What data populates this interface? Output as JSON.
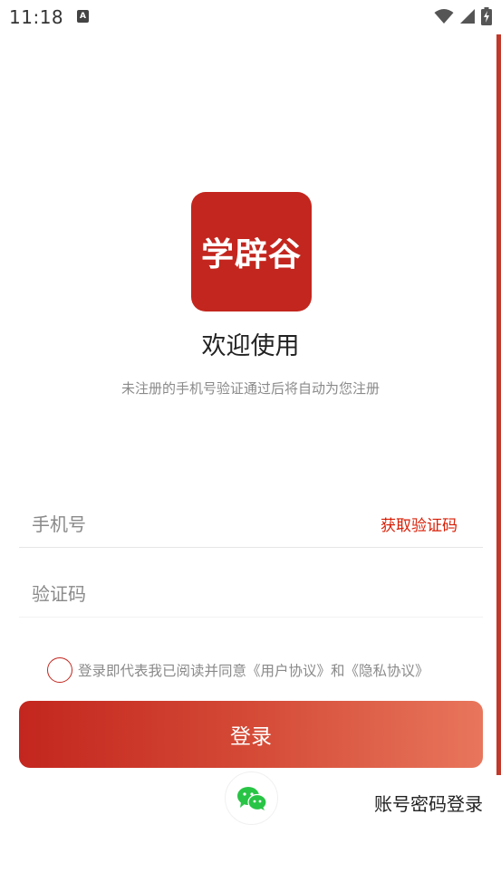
{
  "status_bar": {
    "time": "11:18",
    "notification_icon": "a-notification-icon",
    "wifi_icon": "wifi-icon",
    "signal_icon": "signal-icon",
    "battery_icon": "battery-charging-icon"
  },
  "logo": {
    "text": "学辟谷",
    "background_color": "#c3261e"
  },
  "welcome_title": "欢迎使用",
  "subtitle": "未注册的手机号验证通过后将自动为您注册",
  "phone_field": {
    "placeholder": "手机号",
    "value": ""
  },
  "get_code_label": "获取验证码",
  "code_field": {
    "placeholder": "验证码",
    "value": ""
  },
  "agreement": {
    "checked": false,
    "text": "登录即代表我已阅读并同意《用户协议》和《隐私协议》"
  },
  "login_button_label": "登录",
  "wechat_icon": "wechat-icon",
  "password_login_label": "账号密码登录",
  "colors": {
    "accent": "#c3261e",
    "gradient_end": "#e8765c",
    "link_red": "#d81e06",
    "wechat_green": "#28c445"
  }
}
